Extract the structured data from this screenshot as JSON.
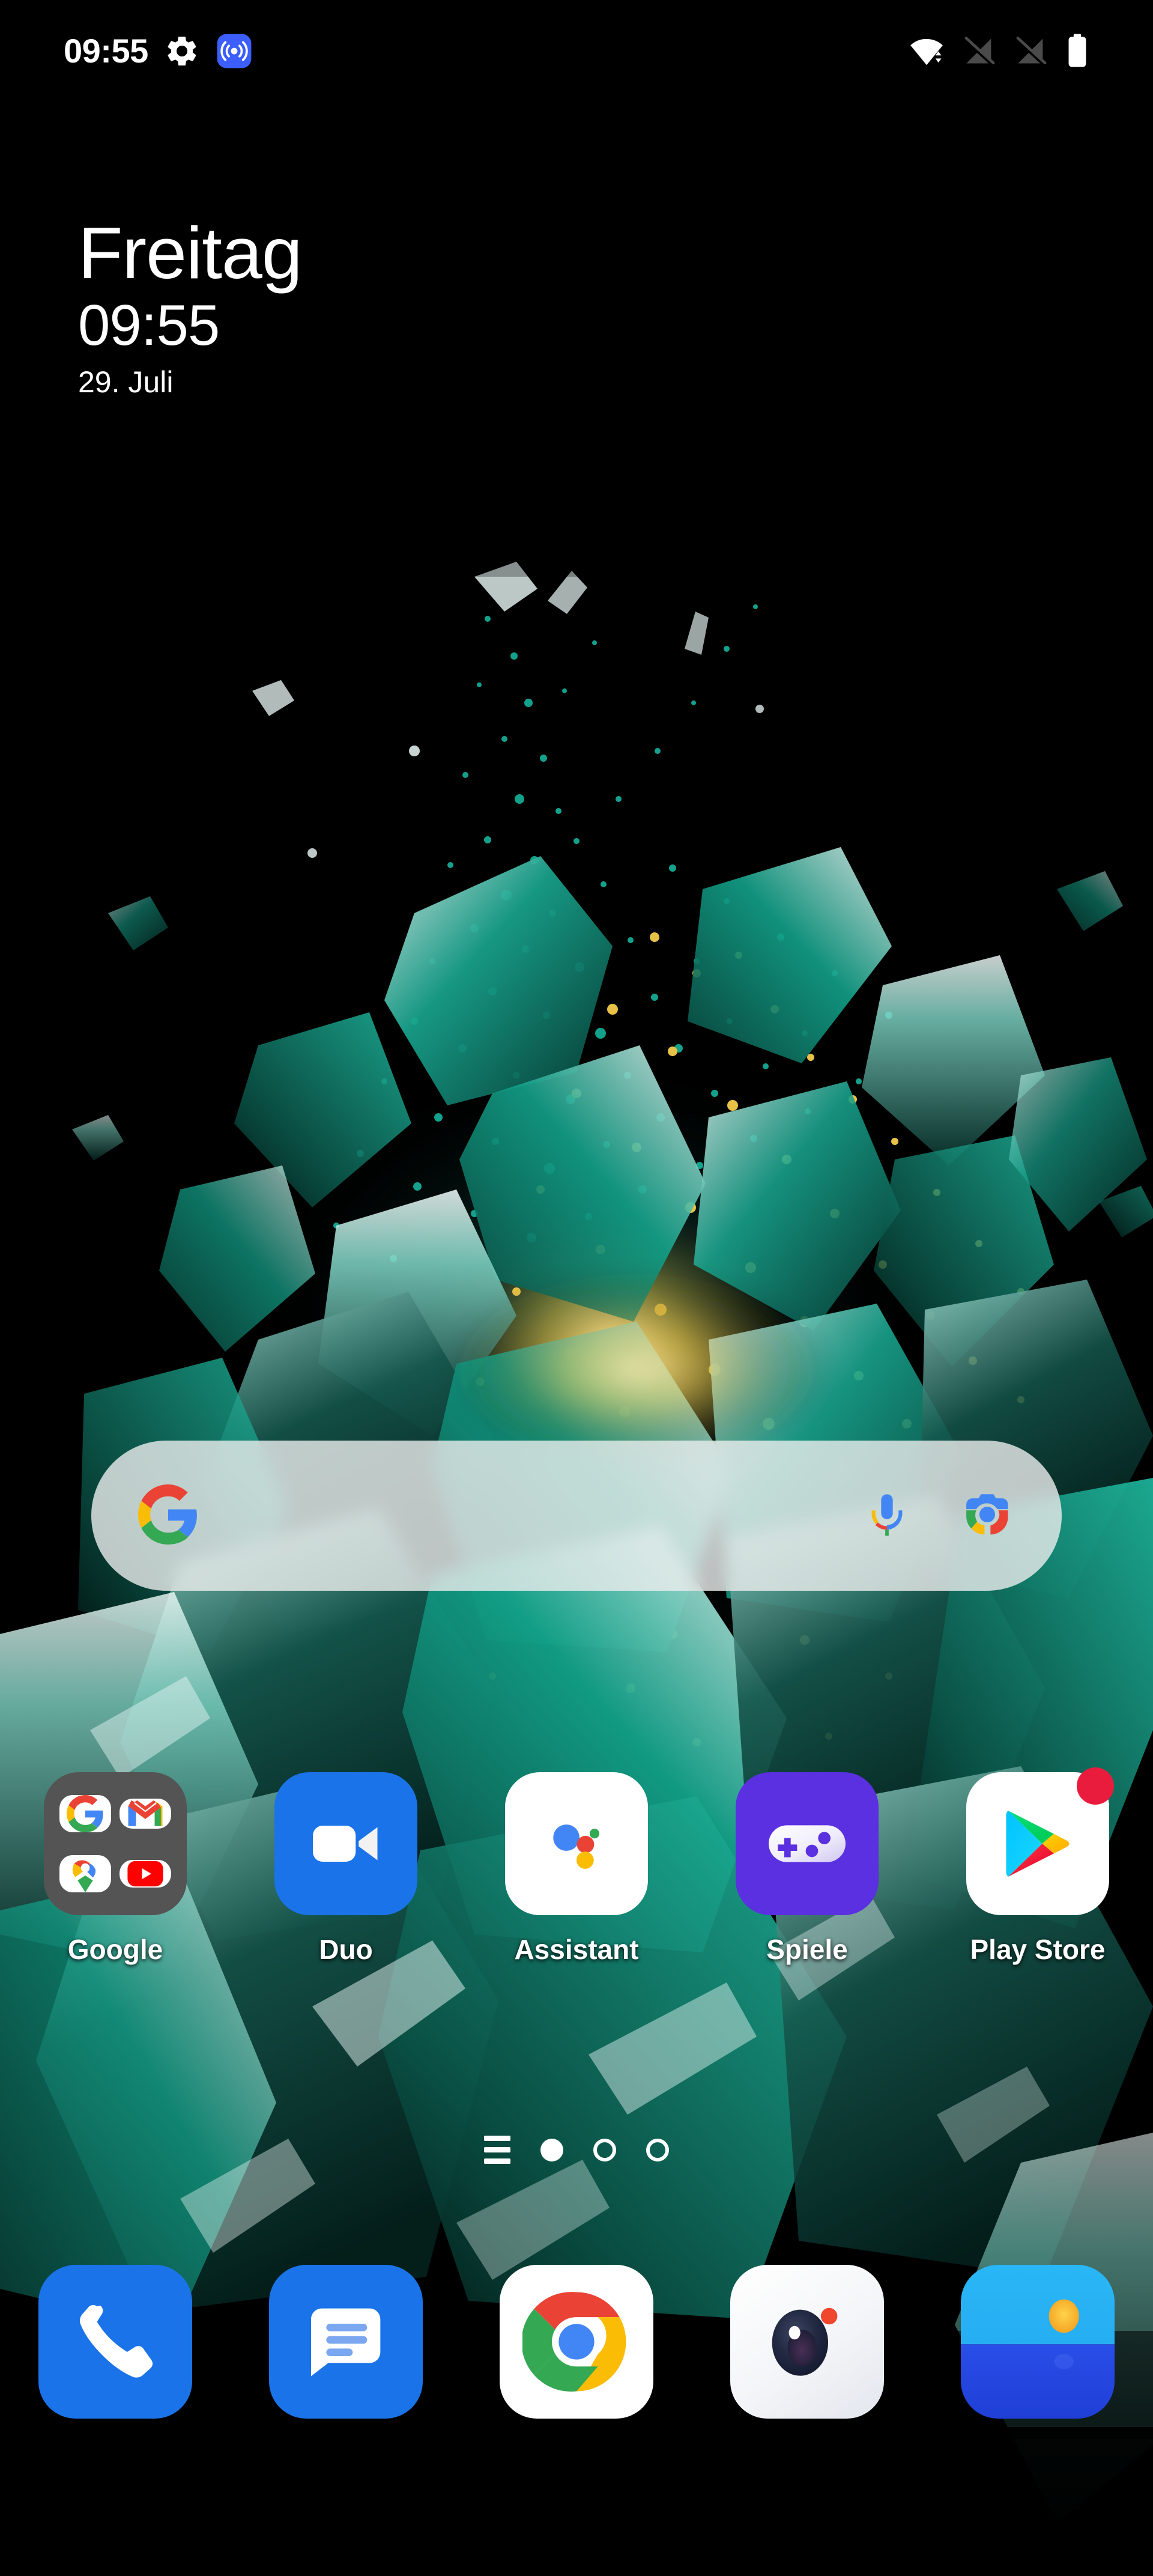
{
  "status_bar": {
    "time": "09:55",
    "left_icons": [
      {
        "name": "settings-gear-icon",
        "label": "Einstellungen"
      },
      {
        "name": "hotspot-icon",
        "label": "Hotspot aktiv",
        "color": "#3b5efc"
      }
    ],
    "right_icons": [
      {
        "name": "wifi-icon",
        "label": "WLAN verbunden"
      },
      {
        "name": "no-sim-signal-icon-1",
        "label": "Kein Netz (SIM 1)"
      },
      {
        "name": "no-sim-signal-icon-2",
        "label": "Kein Netz (SIM 2)"
      },
      {
        "name": "battery-full-icon",
        "label": "Akku voll"
      }
    ]
  },
  "clock_widget": {
    "day": "Freitag",
    "time": "09:55",
    "date": "29. Juli"
  },
  "search": {
    "placeholder": "",
    "value": "",
    "logo_icon": "google-g-icon",
    "mic_icon": "microphone-icon",
    "lens_icon": "google-lens-camera-icon"
  },
  "apps": [
    {
      "label": "Google",
      "icon": "google-folder-icon",
      "type": "folder",
      "folder_apps": [
        {
          "label": "Google",
          "icon": "google-g-icon"
        },
        {
          "label": "Gmail",
          "icon": "gmail-icon"
        },
        {
          "label": "Maps",
          "icon": "google-maps-pin-icon"
        },
        {
          "label": "YouTube",
          "icon": "youtube-icon"
        }
      ]
    },
    {
      "label": "Duo",
      "icon": "duo-video-camera-icon",
      "type": "app",
      "bg": "#1a73e8"
    },
    {
      "label": "Assistant",
      "icon": "google-assistant-dots-icon",
      "type": "app",
      "bg": "#ffffff"
    },
    {
      "label": "Spiele",
      "icon": "play-games-gamepad-icon",
      "type": "app",
      "bg": "#5a30e0"
    },
    {
      "label": "Play Store",
      "icon": "play-store-triangle-icon",
      "type": "app",
      "bg": "#ffffff",
      "badge": true
    }
  ],
  "page_indicator": {
    "discover_icon": "discover-lines-icon",
    "pages": 3,
    "current_page": 1
  },
  "dock": [
    {
      "label": "Telefon",
      "icon": "phone-handset-icon",
      "bg": "#1a73e8"
    },
    {
      "label": "Messages",
      "icon": "messages-bubble-icon",
      "bg": "#1a73e8"
    },
    {
      "label": "Chrome",
      "icon": "chrome-icon",
      "bg": "#ffffff"
    },
    {
      "label": "Kamera",
      "icon": "camera-lens-icon",
      "bg": "#ffffff"
    },
    {
      "label": "Galerie",
      "icon": "gallery-sun-icon",
      "bg": "#2a7de8"
    }
  ],
  "wallpaper": {
    "description": "Zersplitterter Türkis-Kristall mit Goldpartikeln auf Schwarz",
    "accent_color": "#0f9b84",
    "particle_color": "#14b3a0",
    "gold_color": "#e8c247",
    "background_color": "#000000"
  }
}
